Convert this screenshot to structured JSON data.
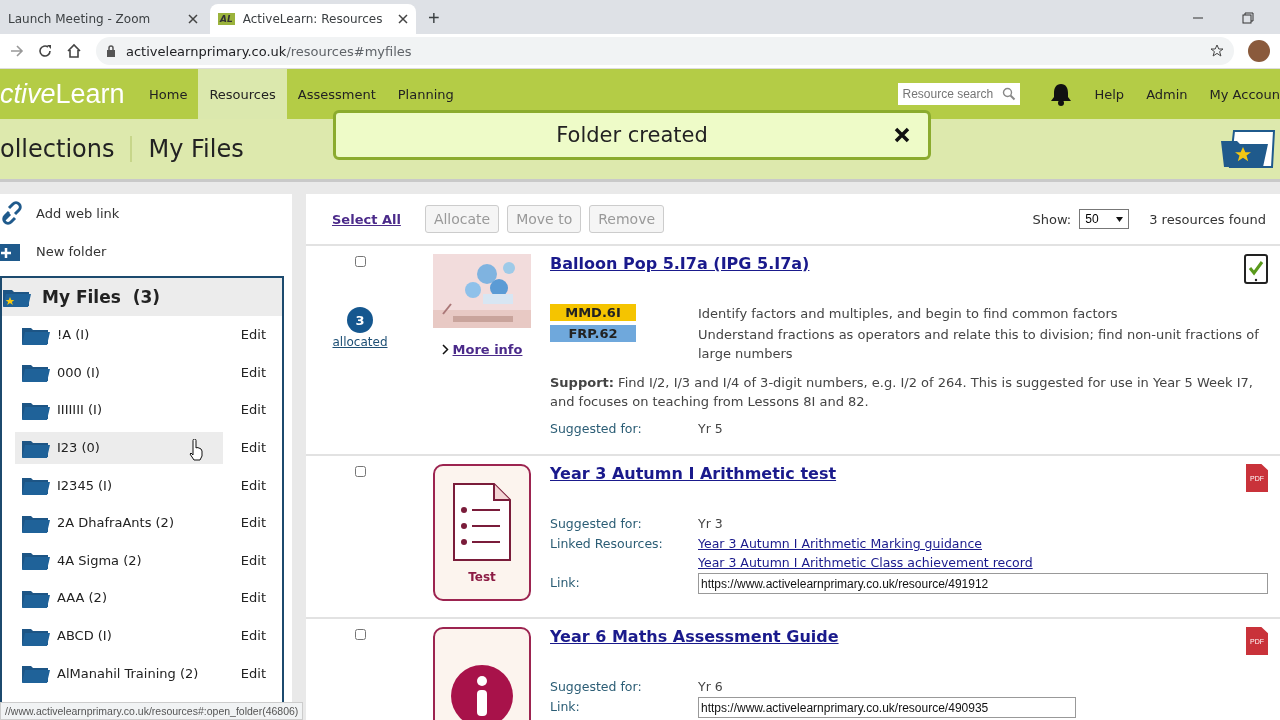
{
  "browser": {
    "tabs": [
      {
        "title": "Launch Meeting - Zoom",
        "selected": false
      },
      {
        "title": "ActiveLearn: Resources",
        "selected": true,
        "favicon": "AL"
      }
    ],
    "new_tab": "+",
    "url_host": "activelearnprimary.co.uk",
    "url_path": "/resources#myfiles"
  },
  "nav": {
    "logo_italic": "ctive",
    "logo_rest": "Learn",
    "items": [
      {
        "label": "Home",
        "selected": false
      },
      {
        "label": "Resources",
        "selected": true
      },
      {
        "label": "Assessment",
        "selected": false
      },
      {
        "label": "Planning",
        "selected": false
      }
    ],
    "search": {
      "placeholder": "Resource search"
    },
    "links": [
      "Help",
      "Admin",
      "My Accoun"
    ]
  },
  "breadcrumb": [
    "ollections",
    "My Files"
  ],
  "toast": {
    "message": "Folder created"
  },
  "sidebar": {
    "actions": [
      {
        "kind": "link",
        "label": "Add web link"
      },
      {
        "kind": "folder",
        "label": "New folder"
      }
    ],
    "root": "My Files  (3)",
    "folders": [
      {
        "name": "!A (I)",
        "edit": "Edit",
        "highlighted": false
      },
      {
        "name": "000 (I)",
        "edit": "Edit",
        "highlighted": false
      },
      {
        "name": "IIIIIII (I)",
        "edit": "Edit",
        "highlighted": false
      },
      {
        "name": "I23 (0)",
        "edit": "Edit",
        "highlighted": true
      },
      {
        "name": "I2345 (I)",
        "edit": "Edit",
        "highlighted": false
      },
      {
        "name": "2A DhafraAnts (2)",
        "edit": "Edit",
        "highlighted": false
      },
      {
        "name": "4A Sigma (2)",
        "edit": "Edit",
        "highlighted": false
      },
      {
        "name": "AAA (2)",
        "edit": "Edit",
        "highlighted": false
      },
      {
        "name": "ABCD (I)",
        "edit": "Edit",
        "highlighted": false
      },
      {
        "name": "AlManahil Training (2)",
        "edit": "Edit",
        "highlighted": false
      }
    ]
  },
  "toolbar": {
    "select_all": "Select All",
    "buttons": [
      {
        "label": "Allocate",
        "disabled": true
      },
      {
        "label": "Move to",
        "disabled": true
      },
      {
        "label": "Remove",
        "disabled": true
      }
    ],
    "show_label": "Show:",
    "show_value": "50",
    "found": "3 resources found"
  },
  "resources": [
    {
      "checked": false,
      "allocated": {
        "count": "3",
        "label": "allocated"
      },
      "thumb": {
        "kind": "picture"
      },
      "more_info": "More info",
      "title": "Balloon Pop 5.I7a (IPG 5.I7a)",
      "format": {
        "kind": "tablet"
      },
      "tags": [
        {
          "code": "MMD.6I",
          "color": "#f5c400",
          "text": "Identify factors and multiples, and begin to find common factors"
        },
        {
          "code": "FRP.62",
          "color": "#6fa8dc",
          "text": "Understand fractions as operators and relate this to division; find non-unit fractions of large numbers"
        }
      ],
      "support": "**Support:** Find I/2, I/3 and I/4 of 3-digit numbers, e.g. I/2 of 264. This is suggested for use in Year 5 Week I7, and focuses on teaching from Lessons 8I and 82.",
      "fields": [
        {
          "kind": "text",
          "label": "Suggested for:",
          "value": "Yr 5"
        }
      ]
    },
    {
      "checked": false,
      "thumb": {
        "kind": "test",
        "label": "Test"
      },
      "title": "Year 3 Autumn I Arithmetic test",
      "format": {
        "kind": "pdf",
        "label": "PDF"
      },
      "fields": [
        {
          "kind": "text",
          "label": "Suggested for:",
          "value": "Yr 3"
        },
        {
          "kind": "links",
          "label": "Linked Resources:",
          "links": [
            "Year 3 Autumn I Arithmetic Marking guidance",
            "Year 3 Autumn I Arithmetic Class achievement record"
          ]
        },
        {
          "kind": "input",
          "label": "Link:",
          "value": "https://www.activelearnprimary.co.uk/resource/491912"
        }
      ]
    },
    {
      "checked": false,
      "thumb": {
        "kind": "info"
      },
      "title": "Year 6 Maths Assessment Guide",
      "format": {
        "kind": "pdf",
        "label": "PDF"
      },
      "fields": [
        {
          "kind": "text",
          "label": "Suggested for:",
          "value": "Yr 6"
        },
        {
          "kind": "input",
          "label": "Link:",
          "value": "https://www.activelearnprimary.co.uk/resource/490935",
          "short": true
        }
      ]
    }
  ],
  "status_url": "//www.activelearnprimary.co.uk/resources#:open_folder(46806)"
}
